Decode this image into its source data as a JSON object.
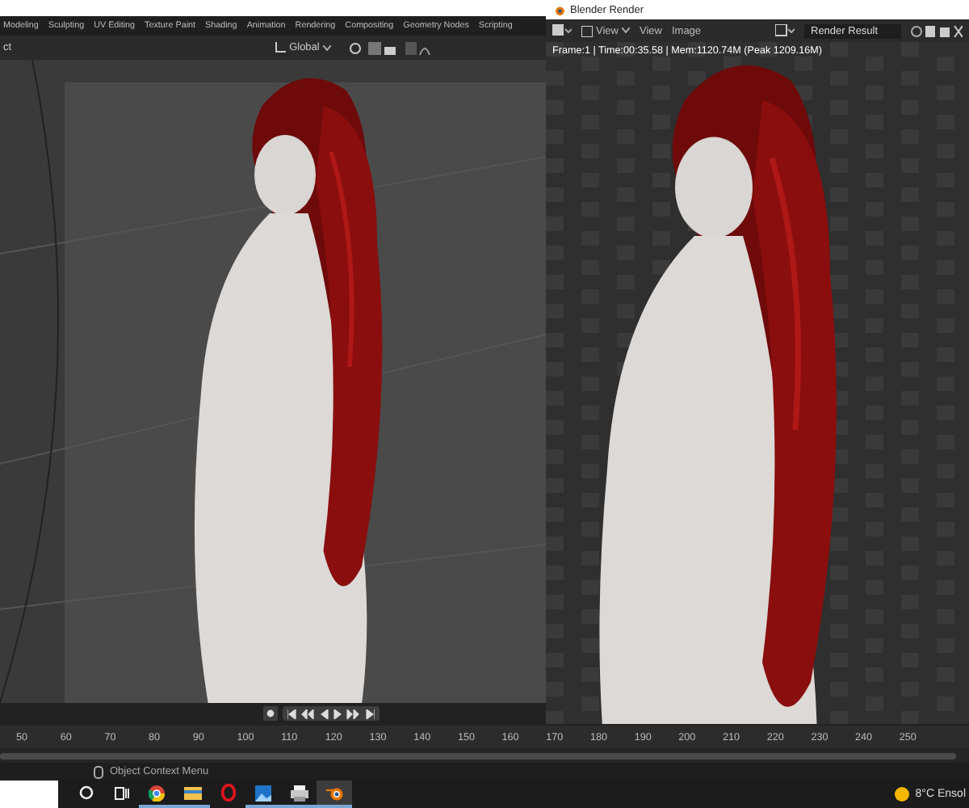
{
  "main_window": {
    "workspace_tabs": [
      "Modeling",
      "Sculpting",
      "UV Editing",
      "Texture Paint",
      "Shading",
      "Animation",
      "Rendering",
      "Compositing",
      "Geometry Nodes",
      "Scripting"
    ],
    "header_text": "ct",
    "orientation": "Global"
  },
  "render_window": {
    "title": "Blender Render",
    "menus": [
      {
        "label": "View",
        "dropdown": true
      },
      {
        "label": "View",
        "dropdown": false
      },
      {
        "label": "Image",
        "dropdown": false
      }
    ],
    "slot": "Render Result",
    "info": "Frame:1 | Time:00:35.58 | Mem:1120.74M (Peak 1209.16M)"
  },
  "timeline": {
    "frames": [
      "50",
      "60",
      "70",
      "80",
      "90",
      "100",
      "110",
      "120",
      "130",
      "140",
      "150",
      "160",
      "170",
      "180",
      "190",
      "200",
      "210",
      "220",
      "230",
      "240",
      "250"
    ]
  },
  "status_bar": {
    "hint": "Object Context Menu"
  },
  "taskbar": {
    "apps": [
      {
        "kind": "chrome",
        "running": true,
        "selected": false
      },
      {
        "kind": "folder",
        "running": true,
        "selected": false
      },
      {
        "kind": "opera",
        "running": false,
        "selected": false
      },
      {
        "kind": "photos",
        "running": true,
        "selected": false
      },
      {
        "kind": "printer",
        "running": true,
        "selected": false
      },
      {
        "kind": "blender",
        "running": true,
        "selected": true
      }
    ],
    "weather": {
      "temperature": "8°C",
      "condition": "Ensol"
    }
  }
}
